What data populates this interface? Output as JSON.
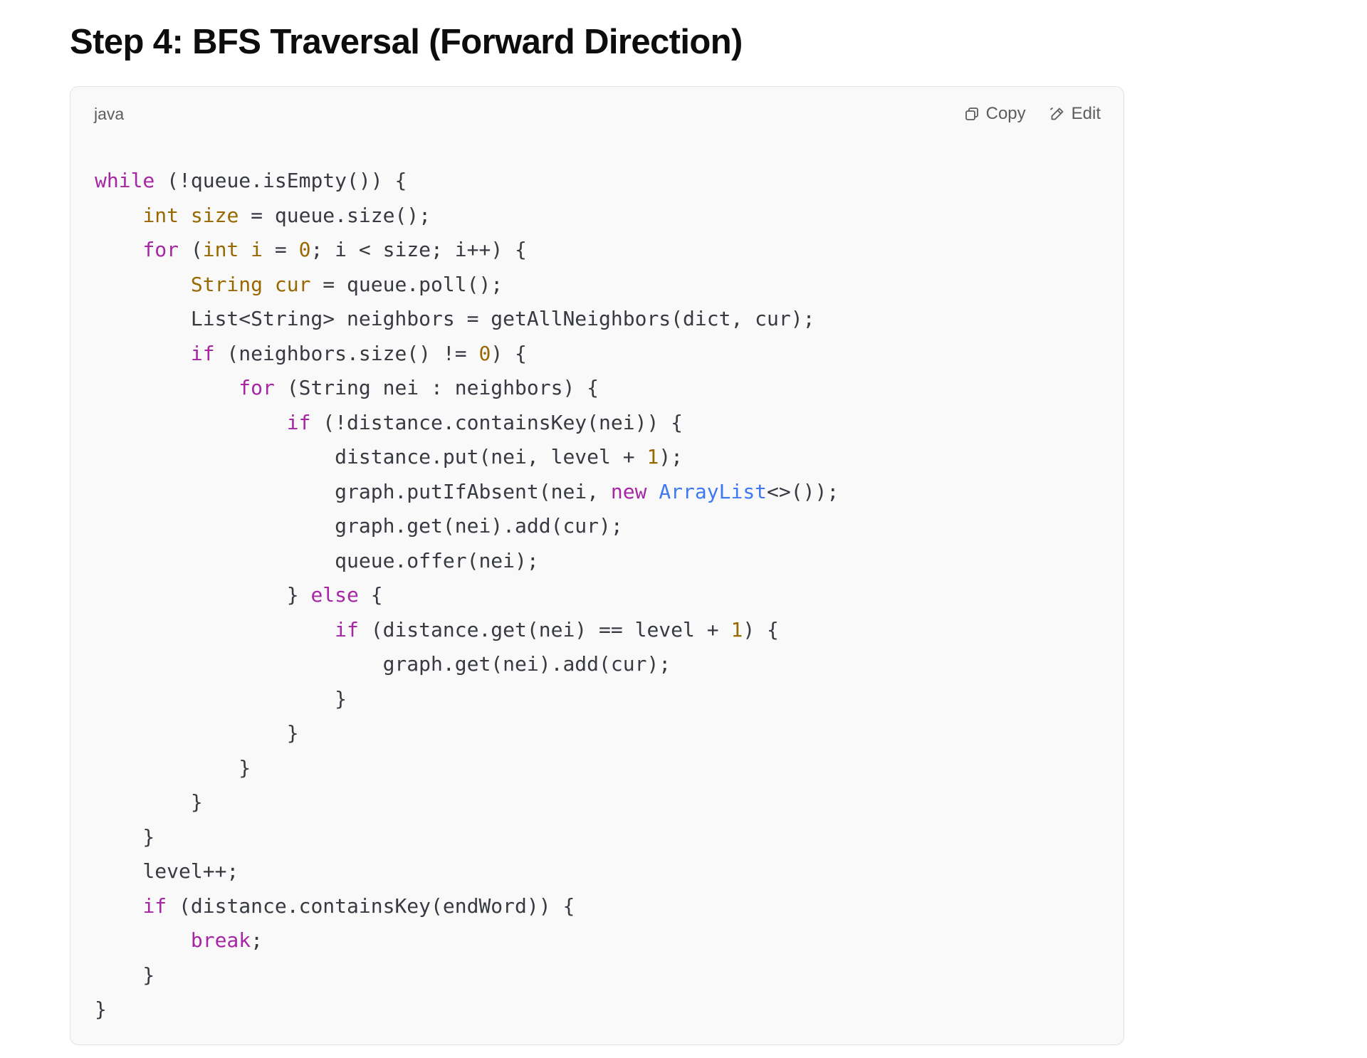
{
  "heading": "Step 4: BFS Traversal (Forward Direction)",
  "code_block": {
    "language": "java",
    "copy_label": "Copy",
    "edit_label": "Edit",
    "copy_icon": "copy-icon",
    "edit_icon": "pencil-icon",
    "colors": {
      "keyword": "#a626a4",
      "type": "#986801",
      "number": "#986801",
      "class": "#4078f2",
      "plain": "#383a42",
      "background": "#f9f9f9"
    },
    "lines": [
      [
        {
          "t": "kw",
          "v": "while"
        },
        {
          "t": "plain",
          "v": " (!queue.isEmpty()) {"
        }
      ],
      [
        {
          "t": "plain",
          "v": "    "
        },
        {
          "t": "type",
          "v": "int size"
        },
        {
          "t": "plain",
          "v": " = queue.size();"
        }
      ],
      [
        {
          "t": "plain",
          "v": "    "
        },
        {
          "t": "kw",
          "v": "for"
        },
        {
          "t": "plain",
          "v": " ("
        },
        {
          "t": "type",
          "v": "int i"
        },
        {
          "t": "plain",
          "v": " = "
        },
        {
          "t": "num",
          "v": "0"
        },
        {
          "t": "plain",
          "v": "; i < size; i++) {"
        }
      ],
      [
        {
          "t": "plain",
          "v": "        "
        },
        {
          "t": "type",
          "v": "String cur"
        },
        {
          "t": "plain",
          "v": " = queue.poll();"
        }
      ],
      [
        {
          "t": "plain",
          "v": "        List<String> neighbors = getAllNeighbors(dict, cur);"
        }
      ],
      [
        {
          "t": "plain",
          "v": "        "
        },
        {
          "t": "kw",
          "v": "if"
        },
        {
          "t": "plain",
          "v": " (neighbors.size() != "
        },
        {
          "t": "num",
          "v": "0"
        },
        {
          "t": "plain",
          "v": ") {"
        }
      ],
      [
        {
          "t": "plain",
          "v": "            "
        },
        {
          "t": "kw",
          "v": "for"
        },
        {
          "t": "plain",
          "v": " (String nei : neighbors) {"
        }
      ],
      [
        {
          "t": "plain",
          "v": "                "
        },
        {
          "t": "kw",
          "v": "if"
        },
        {
          "t": "plain",
          "v": " (!distance.containsKey(nei)) {"
        }
      ],
      [
        {
          "t": "plain",
          "v": "                    distance.put(nei, level + "
        },
        {
          "t": "num",
          "v": "1"
        },
        {
          "t": "plain",
          "v": ");"
        }
      ],
      [
        {
          "t": "plain",
          "v": "                    graph.putIfAbsent(nei, "
        },
        {
          "t": "kw",
          "v": "new"
        },
        {
          "t": "plain",
          "v": " "
        },
        {
          "t": "cls",
          "v": "ArrayList"
        },
        {
          "t": "plain",
          "v": "<>());"
        }
      ],
      [
        {
          "t": "plain",
          "v": "                    graph.get(nei).add(cur);"
        }
      ],
      [
        {
          "t": "plain",
          "v": "                    queue.offer(nei);"
        }
      ],
      [
        {
          "t": "plain",
          "v": "                } "
        },
        {
          "t": "kw",
          "v": "else"
        },
        {
          "t": "plain",
          "v": " {"
        }
      ],
      [
        {
          "t": "plain",
          "v": "                    "
        },
        {
          "t": "kw",
          "v": "if"
        },
        {
          "t": "plain",
          "v": " (distance.get(nei) == level + "
        },
        {
          "t": "num",
          "v": "1"
        },
        {
          "t": "plain",
          "v": ") {"
        }
      ],
      [
        {
          "t": "plain",
          "v": "                        graph.get(nei).add(cur);"
        }
      ],
      [
        {
          "t": "plain",
          "v": "                    }"
        }
      ],
      [
        {
          "t": "plain",
          "v": "                }"
        }
      ],
      [
        {
          "t": "plain",
          "v": "            }"
        }
      ],
      [
        {
          "t": "plain",
          "v": "        }"
        }
      ],
      [
        {
          "t": "plain",
          "v": "    }"
        }
      ],
      [
        {
          "t": "plain",
          "v": "    level++;"
        }
      ],
      [
        {
          "t": "plain",
          "v": "    "
        },
        {
          "t": "kw",
          "v": "if"
        },
        {
          "t": "plain",
          "v": " (distance.containsKey(endWord)) {"
        }
      ],
      [
        {
          "t": "plain",
          "v": "        "
        },
        {
          "t": "kw",
          "v": "break"
        },
        {
          "t": "plain",
          "v": ";"
        }
      ],
      [
        {
          "t": "plain",
          "v": "    }"
        }
      ],
      [
        {
          "t": "plain",
          "v": "}"
        }
      ]
    ]
  }
}
